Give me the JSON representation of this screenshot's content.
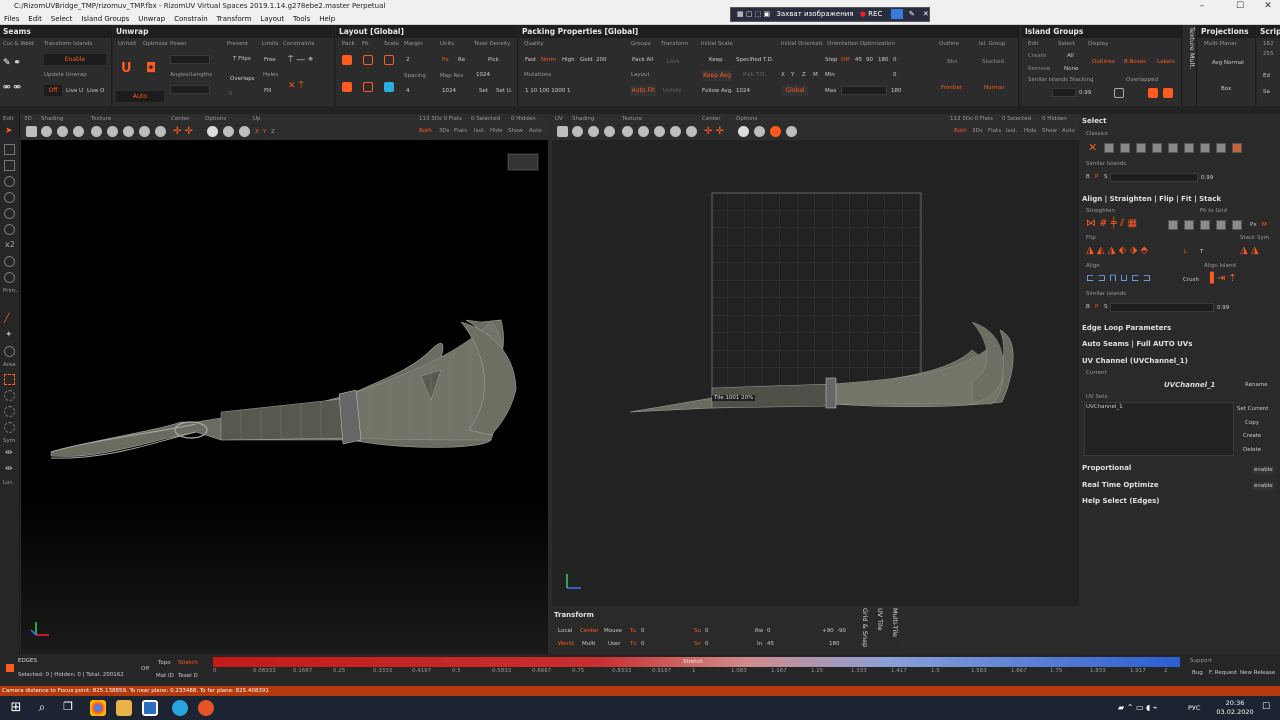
{
  "window": {
    "title": "C:/RizomUVBridge_TMP/rizomuv_TMP.fbx - RizomUV  Virtual Spaces 2019.1.14.g278ebe2.master Perpetual"
  },
  "menu": [
    "Files",
    "Edit",
    "Select",
    "Island Groups",
    "Unwrap",
    "Constrain",
    "Transform",
    "Layout",
    "Tools",
    "Help"
  ],
  "recorder": {
    "label": "Захват изображения",
    "rec": "REC"
  },
  "ribbon": {
    "seams": {
      "title": "Seams",
      "cut_weld": "Cut & Weld",
      "transform_islands": "Transform Islands",
      "enable": "Enable",
      "update_unwrap": "Update Unwrap",
      "off": "Off",
      "live_u": "Live U",
      "live_o": "Live O"
    },
    "unwrap": {
      "title": "Unwrap",
      "unfold": "Unfold",
      "optimize": "Optimize",
      "power": "Power",
      "prevent": "Prevent",
      "limits": "Limits",
      "constraints": "Constraints",
      "t_flips": "T Flips",
      "free": "Free",
      "angles_lengths": "Angles/Lengths",
      "overlaps": "Overlaps",
      "holes": "Holes",
      "fill": "Fill",
      "auto": "Auto",
      "zero": "0"
    },
    "layout": {
      "title": "Layout [Global]",
      "pack": "Pack",
      "fit": "Fit",
      "scale": "Scale",
      "margin": "Margin",
      "units": "Units",
      "texel_density": "Texel Density",
      "margin_val": "2",
      "px": "Px",
      "re": "Re",
      "pick": "Pick",
      "spacing": "Spacing",
      "map_res": "Map Res",
      "spacing_val": "4",
      "res1": "1024",
      "res2": "1024",
      "set": "Set",
      "set_u": "Set U."
    },
    "packing": {
      "title": "Packing Properties [Global]",
      "quality": "Quality",
      "groups": "Groups",
      "transform": "Transform",
      "initial_scale": "Initial Scale",
      "initial_orient": "Initial Orientati.",
      "orient_opt": "Orientation Optimization",
      "fast": "Fast",
      "norm": "Norm",
      "high": "High",
      "gold": "Gold",
      "gold_val": "200",
      "pack_all": "Pack All",
      "lock": "Lock",
      "keep": "Keep",
      "specified_td": "Specified T.D.",
      "step": "Step",
      "off": "Off",
      "s45": "45",
      "s90": "90",
      "s180": "180",
      "s0": "0",
      "mutations": "Mutations",
      "layout": "Layout",
      "keep_avg": "Keep Avg",
      "pick_td": "Pick T.D.",
      "x": "X",
      "y": "Y",
      "z": "Z",
      "m": "M",
      "min": "Min",
      "min_val": "0",
      "mut_vals": "1   10   100   1000   1",
      "auto_fit": "Auto Fit",
      "unfold": "Unfold",
      "follow_avg": "Follow Avg.",
      "follow_val": "1024",
      "global": "Global",
      "max": "Max",
      "max_val": "180"
    },
    "outline": {
      "outline": "Outline",
      "bbx": "Bbx",
      "frontier": "Frontier"
    },
    "isl_group": {
      "title": "Isl. Group",
      "stacked": "Stacked",
      "normal": "Normal"
    },
    "island_groups": {
      "title": "Island Groups",
      "edit": "Edit",
      "select": "Select",
      "display": "Display",
      "create": "Create",
      "all": "All",
      "outlines": "Outlines",
      "bboxes": "B.Boxes",
      "labels": "Labels",
      "remove": "Remove",
      "none": "None",
      "similar": "Similar Islands Stacking",
      "overlapped": "Overlapped",
      "val": "0.99"
    },
    "texture_mult": "Texture Mult.",
    "projections": {
      "title": "Projections",
      "multi_planar": "Multi-Planar",
      "avg_normal": "Avg Normal",
      "box": "Box"
    },
    "script": {
      "title": "Scrip",
      "ed": "Ed",
      "sa": "Sa",
      "n162": "162",
      "n255": "255"
    }
  },
  "left_tools": {
    "edit": "Edit",
    "x2": "x2",
    "prim": "Prim.",
    "area": "Area",
    "sym": "Sym.",
    "loc": "Loc."
  },
  "viewport3d": {
    "labels": {
      "l3d": "3D",
      "shading": "Shading",
      "texture": "Texture",
      "center": "Center",
      "options": "Options",
      "up": "Up",
      "x": "X",
      "y": "Y",
      "z": "Z"
    },
    "stats": "113 3Ds 0 Flats",
    "selected": "0 Selected",
    "hidden": "0 Hidden",
    "modes": [
      "Both",
      "3Ds",
      "Flats",
      "Isol.",
      "Hide",
      "Show",
      "Auto"
    ]
  },
  "viewportuv": {
    "labels": {
      "uv": "UV",
      "shading": "Shading",
      "texture": "Texture",
      "center": "Center",
      "options": "Options"
    },
    "stats": "113 3Ds 0 Flats",
    "selected": "0 Selected",
    "hidden": "0 Hidden",
    "modes": [
      "Both",
      "3Ds",
      "Flats",
      "Isol.",
      "Hide",
      "Show",
      "Auto"
    ],
    "tile": "Tile 1001 20%"
  },
  "right": {
    "select": "Select",
    "classics": "Classics",
    "similar_islands": "Similar Islands",
    "val1": "0.99",
    "align": "Align | Straighten | Flip | Fit | Stack",
    "straighten": "Straighten",
    "fit_to_grid": "Fit to Grid",
    "flip": "Flip",
    "stack_sym": "Stack Sym.",
    "align_label": "Align",
    "align_island": "Align Island",
    "crush": "Crush",
    "similar_islands2": "Similar Islands",
    "val2": "0.99",
    "px": "Px",
    "m": "M",
    "l": "L",
    "t": "T",
    "b": "B",
    "p": "P",
    "s": "S",
    "edge_loop": "Edge Loop Parameters",
    "auto_seams": "Auto Seams | Full AUTO UVs",
    "uv_channel": "UV Channel (UVChannel_1)",
    "current": "Current",
    "current_val": "UVChannel_1",
    "rename": "Rename",
    "uv_sets": "UV Sets",
    "uv_set_item": "UVChannel_1",
    "set_current": "Set Current",
    "copy": "Copy",
    "create": "Create",
    "delete": "Delete",
    "proportional": "Proportional",
    "real_time": "Real Time Optimize",
    "help_select": "Help Select (Edges)",
    "enable": "enable"
  },
  "transform": {
    "title": "Transform",
    "local": "Local",
    "center": "Center",
    "mouse": "Mouse",
    "world": "World",
    "multi": "Multi",
    "user": "User",
    "tu": "Tu",
    "tv": "Tv",
    "su": "Su",
    "sv": "Sv",
    "rw": "Rw",
    "in": "In",
    "v0": "0",
    "rot1": "+90",
    "rot2": "-90",
    "rot3": "180",
    "in_val": "45",
    "zero": "0"
  },
  "vtabs": [
    "Grid & Snap",
    "UV Tile",
    "Multi-Tile"
  ],
  "bottom": {
    "mode": "EDGES",
    "selinfo": "Selected: 0 | Hidden: 0 | Total: 200162",
    "off": "Off",
    "topo": "Topo",
    "stretch": "Stretch",
    "mat_id": "Mat ID",
    "texel_d": "Texel D",
    "stretch_label": "Stretch",
    "ticks": [
      "0",
      "0.08333",
      "0.1667",
      "0.25",
      "0.3333",
      "0.4167",
      "0.5",
      "0.5833",
      "0.6667",
      "0.75",
      "0.8333",
      "0.9167",
      "1",
      "1.083",
      "1.167",
      "1.25",
      "1.333",
      "1.417",
      "1.5",
      "1.583",
      "1.667",
      "1.75",
      "1.833",
      "1.917",
      "2"
    ],
    "support": "Support",
    "bug": "Bug",
    "f_request": "F. Request",
    "new_release": "New Release"
  },
  "status": "Camera distance to Focus point: 825.138859. To near plane: 0.233488. To far plane: 825.408391",
  "taskbar": {
    "lang": "РУС",
    "time": "20:36",
    "date": "03.02.2020"
  },
  "colors": {
    "accent": "#ff5a1f",
    "bg": "#2b2b2b",
    "viewport": "#000000",
    "status": "#b33a0c"
  }
}
